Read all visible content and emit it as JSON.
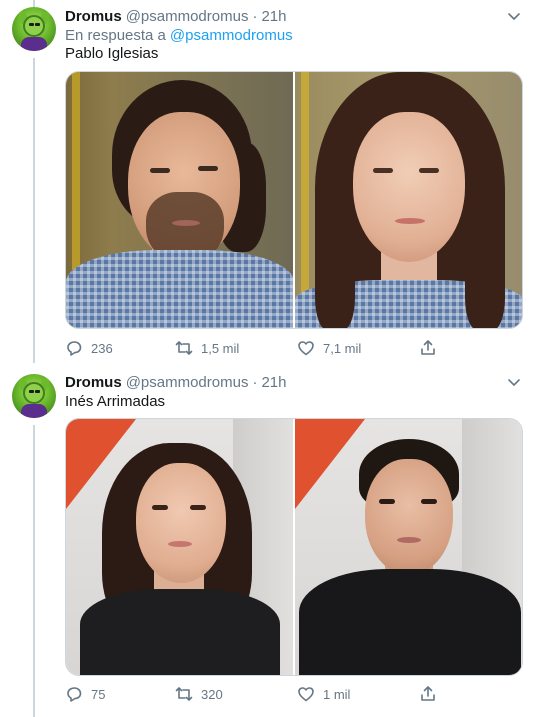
{
  "tweets": [
    {
      "author_name": "Dromus",
      "author_handle": "@psammodromus",
      "separator": "·",
      "time": "21h",
      "reply_prefix": "En respuesta a",
      "reply_mention": "@psammodromus",
      "text": "Pablo Iglesias",
      "replies": "236",
      "retweets": "1,5 mil",
      "likes": "7,1 mil",
      "icons": [
        "caret-down-icon",
        "reply-icon",
        "retweet-icon",
        "like-icon",
        "share-icon"
      ]
    },
    {
      "author_name": "Dromus",
      "author_handle": "@psammodromus",
      "separator": "·",
      "time": "21h",
      "text": "Inés Arrimadas",
      "replies": "75",
      "retweets": "320",
      "likes": "1 mil",
      "icons": [
        "caret-down-icon",
        "reply-icon",
        "retweet-icon",
        "like-icon",
        "share-icon"
      ]
    }
  ],
  "colors": {
    "accent": "#1da1f2",
    "text_primary": "#14171a",
    "text_secondary": "#657786",
    "border": "#ccd6dd"
  }
}
